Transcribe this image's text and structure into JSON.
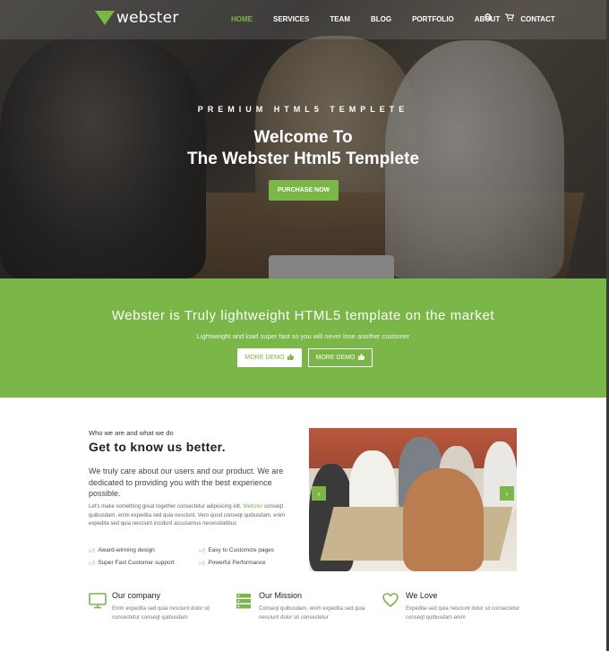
{
  "header": {
    "logo_text": "webster",
    "nav": [
      {
        "label": "HOME",
        "active": true
      },
      {
        "label": "SERVICES"
      },
      {
        "label": "TEAM"
      },
      {
        "label": "BLOG"
      },
      {
        "label": "PORTFOLIO"
      },
      {
        "label": "ABOUT"
      },
      {
        "label": "CONTACT"
      }
    ],
    "icons": [
      "search-icon",
      "cart-icon"
    ]
  },
  "hero": {
    "subtitle": "PREMIUM HTML5 TEMPLETE",
    "title_line1": "Welcome To",
    "title_line2": "The Webster Html5 Templete",
    "button": "PURCHASE NOW"
  },
  "band": {
    "title": "Webster is Truly lightweight HTML5 template on the market",
    "subtitle": "Lightweight and load super fast so you will never lose another customer",
    "button_primary": "MORE DEMO",
    "button_secondary": "MORE DEMO"
  },
  "about": {
    "small": "Who we are and what we do",
    "title": "Get to know us better.",
    "lead": "We truly care about our users and our product. We are dedicated to providing you with the best experience possible.",
    "body_before": "Let's make something great together consectetur adipisicing elit. ",
    "body_link": "Webster",
    "body_after": " conseqt quibusdam, enim expedita sed quia nesciunt. Vero quod conseqt quibusdam, enim expedita sed quia nesciunt incidunt accusamus necessitatibus",
    "features": [
      "Award-winning design",
      "Easy to Customize pages",
      "Super Fast Customer support",
      "Powerful Performance"
    ]
  },
  "services": [
    {
      "title": "Our company",
      "text": "Enim expedita sed quia nesciunt dolor sit consectetur conseqt quibusdam",
      "icon": "monitor-icon"
    },
    {
      "title": "Our Mission",
      "text": "Conseqt quibusdam, enim expedita sed quia nesciunt dolor sit consectetur",
      "icon": "server-icon"
    },
    {
      "title": "We Love",
      "text": "Expedita sed quia nesciunt dolor sit consectetur conseqt quibusdam enim",
      "icon": "heart-icon"
    }
  ],
  "colors": {
    "accent": "#7ab648"
  }
}
